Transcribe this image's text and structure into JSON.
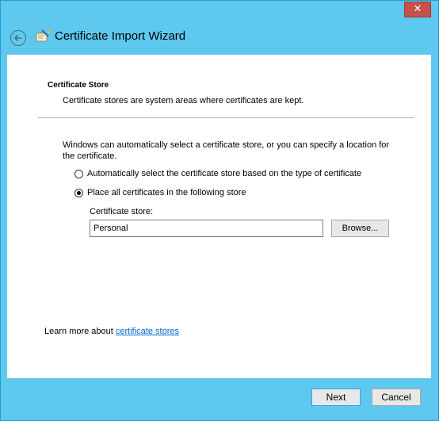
{
  "window": {
    "title": "Certificate Import Wizard",
    "close_glyph": "✕",
    "colors": {
      "frame": "#5fc8ee",
      "close": "#c7504a",
      "link": "#0066cc"
    }
  },
  "icons": {
    "back": "back-arrow-icon",
    "wizard": "certificate-wizard-icon",
    "close": "close-icon"
  },
  "section": {
    "heading": "Certificate Store",
    "description": "Certificate stores are system areas where certificates are kept."
  },
  "intro_text": "Windows can automatically select a certificate store, or you can specify a location for the certificate.",
  "options": [
    {
      "label": "Automatically select the certificate store based on the type of certificate",
      "checked": false
    },
    {
      "label": "Place all certificates in the following store",
      "checked": true
    }
  ],
  "store": {
    "label": "Certificate store:",
    "value": "Personal",
    "browse_label": "Browse..."
  },
  "learn_more": {
    "prefix": "Learn more about ",
    "link_text": "certificate stores"
  },
  "footer": {
    "next_label": "Next",
    "cancel_label": "Cancel"
  }
}
